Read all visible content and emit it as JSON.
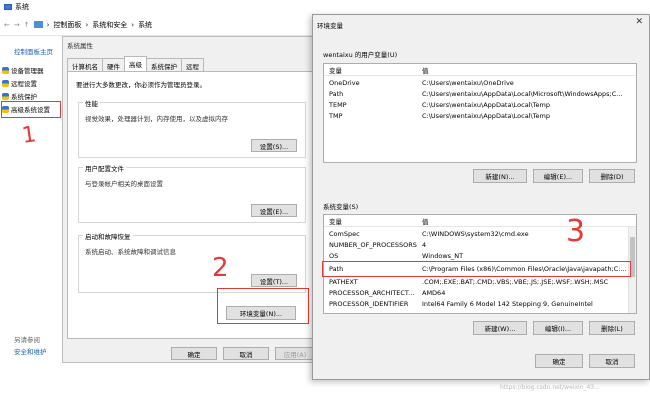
{
  "window_title": "系统",
  "address": {
    "crumb1": "控制面板",
    "crumb2": "系统和安全",
    "crumb3": "系统"
  },
  "sidebar": {
    "home": "控制面板主页",
    "items": [
      {
        "label": "设备管理器"
      },
      {
        "label": "远程设置"
      },
      {
        "label": "系统保护"
      },
      {
        "label": "高级系统设置"
      }
    ],
    "see_also": "另请参阅",
    "security": "安全和维护"
  },
  "sysprop": {
    "title": "系统属性",
    "tabs": [
      "计算机名",
      "硬件",
      "高级",
      "系统保护",
      "远程"
    ],
    "admin_note": "要进行大多数更改，你必须作为管理员登录。",
    "perf": {
      "title": "性能",
      "desc": "视觉效果，处理器计划，内存使用，以及虚拟内存",
      "btn": "设置(S)..."
    },
    "profile": {
      "title": "用户配置文件",
      "desc": "与登录帐户相关的桌面设置",
      "btn": "设置(E)..."
    },
    "startup": {
      "title": "启动和故障恢复",
      "desc": "系统启动、系统故障和调试信息",
      "btn": "设置(T)..."
    },
    "env_btn": "环境变量(N)...",
    "ok": "确定",
    "cancel": "取消",
    "apply": "应用(A)"
  },
  "env": {
    "title": "环境变量",
    "user_label": "wentaixu 的用户变量(U)",
    "col_var": "变量",
    "col_val": "值",
    "user_vars": [
      {
        "name": "OneDrive",
        "value": "C:\\Users\\wentaixu\\OneDrive"
      },
      {
        "name": "Path",
        "value": "C:\\Users\\wentaixu\\AppData\\Local\\Microsoft\\WindowsApps;C..."
      },
      {
        "name": "TEMP",
        "value": "C:\\Users\\wentaixu\\AppData\\Local\\Temp"
      },
      {
        "name": "TMP",
        "value": "C:\\Users\\wentaixu\\AppData\\Local\\Temp"
      }
    ],
    "user_btns": {
      "new": "新建(N)...",
      "edit": "编辑(E)...",
      "del": "删除(D)"
    },
    "sys_label": "系统变量(S)",
    "sys_vars": [
      {
        "name": "ComSpec",
        "value": "C:\\WINDOWS\\system32\\cmd.exe"
      },
      {
        "name": "NUMBER_OF_PROCESSORS",
        "value": "4"
      },
      {
        "name": "OS",
        "value": "Windows_NT"
      },
      {
        "name": "Path",
        "value": "C:\\Program Files (x86)\\Common Files\\Oracle\\Java\\javapath;C:..."
      },
      {
        "name": "PATHEXT",
        "value": ".COM;.EXE;.BAT;.CMD;.VBS;.VBE;.JS;.JSE;.WSF;.WSH;.MSC"
      },
      {
        "name": "PROCESSOR_ARCHITECT...",
        "value": "AMD64"
      },
      {
        "name": "PROCESSOR_IDENTIFIER",
        "value": "Intel64 Family 6 Model 142 Stepping 9, GenuineIntel"
      }
    ],
    "sys_btns": {
      "new": "新建(W)...",
      "edit": "编辑(I)...",
      "del": "删除(L)"
    },
    "ok": "确定",
    "cancel": "取消"
  },
  "annotations": {
    "n1": "1",
    "n2": "2",
    "n3": "3"
  },
  "watermark": "https://blog.csdn.net/weixin_43..."
}
